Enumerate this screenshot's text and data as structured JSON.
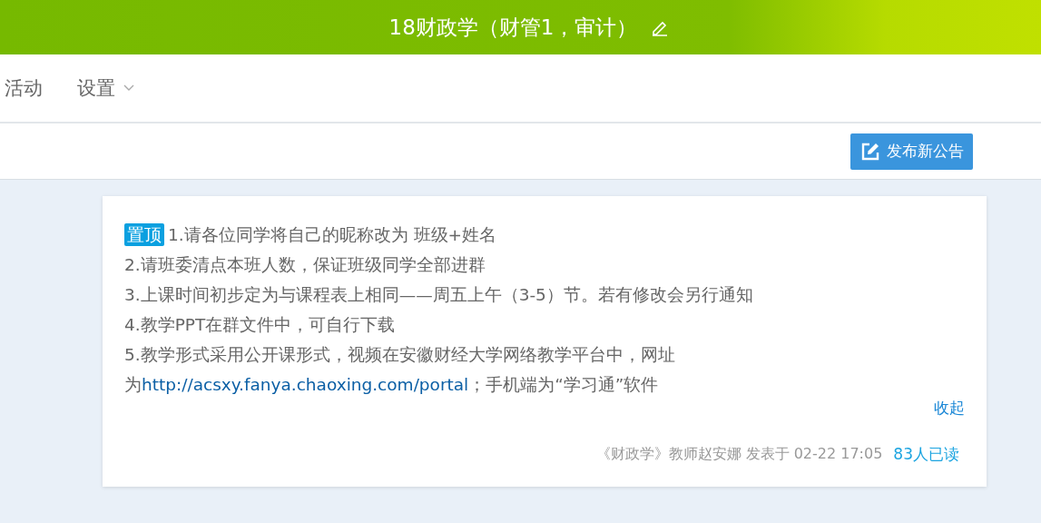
{
  "header": {
    "title": "18财政学（财管1，审计）"
  },
  "nav": [
    {
      "label": "活动",
      "kind": "link"
    },
    {
      "label": "设置",
      "kind": "dropdown"
    }
  ],
  "toolbar": {
    "button": "发布新公告"
  },
  "notice": {
    "pinned_badge": "置顶",
    "lines": [
      "1.请各位同学将自己的昵称改为 班级+姓名",
      "2.请班委清点本班人数，保证班级同学全部进群",
      "3.上课时间初步定为与课程表上相同——周五上午（3-5）节。若有修改会另行通知",
      "4.教学PPT在群文件中，可自行下载",
      "5.教学形式采用公开课形式，视频在安徽财经大学网络教学平台中，网址"
    ],
    "link_line": {
      "prefix": "为",
      "link": "http://acsxy.fanya.chaoxing.com/portal",
      "suffix": "；手机端为“学习通”软件"
    },
    "collapse": "收起",
    "meta": "《财政学》教师赵安娜 发表于 02-22 17:05",
    "read_count": "83人已读"
  }
}
